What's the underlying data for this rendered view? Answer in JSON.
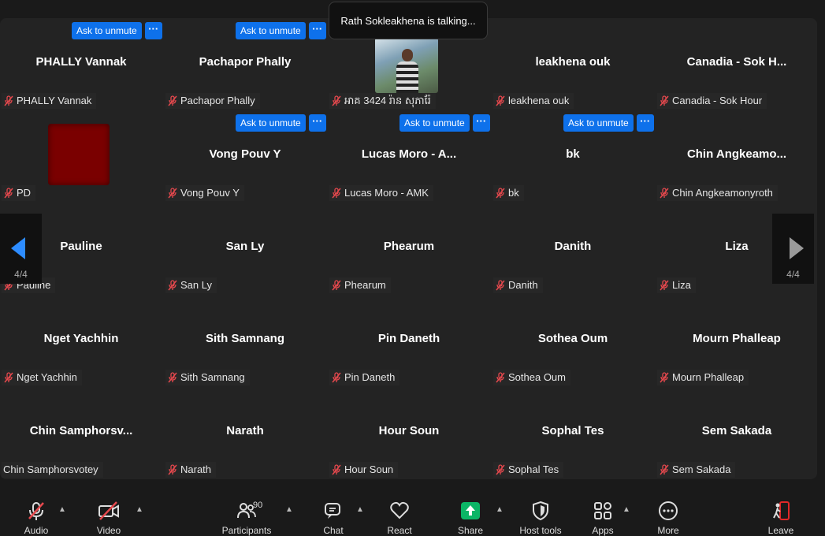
{
  "talking_indicator": "Rath Sokleakhena is talking...",
  "unmute_label": "Ask to unmute",
  "more_dots": "···",
  "pagination": {
    "current": "4/4"
  },
  "participants": [
    {
      "display": "PHALLY Vannak",
      "tag": "PHALLY Vannak",
      "unmute": true
    },
    {
      "display": "Pachapor Phally",
      "tag": "Pachapor Phally",
      "unmute": true
    },
    {
      "display": "",
      "tag": "អាគ 3424 រ៉ាន សុភារ៉ែ",
      "unmute": false,
      "photo": true
    },
    {
      "display": "leakhena ouk",
      "tag": "leakhena ouk",
      "unmute": false
    },
    {
      "display": "Canadia - Sok H...",
      "tag": "Canadia - Sok Hour",
      "unmute": false
    },
    {
      "display": "",
      "tag": "PD",
      "unmute": false,
      "red_avatar": true
    },
    {
      "display": "Vong Pouv Y",
      "tag": "Vong Pouv Y",
      "unmute": true
    },
    {
      "display": "Lucas Moro - A...",
      "tag": "Lucas Moro - AMK",
      "unmute": true
    },
    {
      "display": "bk",
      "tag": "bk",
      "unmute": true
    },
    {
      "display": "Chin  Angkeamo...",
      "tag": "Chin Angkeamonyroth",
      "unmute": false
    },
    {
      "display": "Pauline",
      "tag": "Pauline",
      "unmute": false
    },
    {
      "display": "San Ly",
      "tag": "San Ly",
      "unmute": false
    },
    {
      "display": "Phearum",
      "tag": "Phearum",
      "unmute": false
    },
    {
      "display": "Danith",
      "tag": "Danith",
      "unmute": false
    },
    {
      "display": "Liza",
      "tag": "Liza",
      "unmute": false
    },
    {
      "display": "Nget Yachhin",
      "tag": "Nget Yachhin",
      "unmute": false
    },
    {
      "display": "Sith Samnang",
      "tag": "Sith Samnang",
      "unmute": false
    },
    {
      "display": "Pin Daneth",
      "tag": "Pin Daneth",
      "unmute": false
    },
    {
      "display": "Sothea Oum",
      "tag": "Sothea Oum",
      "unmute": false
    },
    {
      "display": "Mourn Phalleap",
      "tag": "Mourn Phalleap",
      "unmute": false
    },
    {
      "display": "Chin  Samphorsv...",
      "tag": "Chin Samphorsvotey",
      "unmute": false,
      "no_mic": true
    },
    {
      "display": "Narath",
      "tag": "Narath",
      "unmute": false
    },
    {
      "display": "Hour Soun",
      "tag": "Hour Soun",
      "unmute": false
    },
    {
      "display": "Sophal Tes",
      "tag": "Sophal Tes",
      "unmute": false
    },
    {
      "display": "Sem Sakada",
      "tag": "Sem Sakada",
      "unmute": false
    }
  ],
  "toolbar": {
    "audio": "Audio",
    "video": "Video",
    "participants": "Participants",
    "participants_count": "90",
    "chat": "Chat",
    "react": "React",
    "share": "Share",
    "host_tools": "Host tools",
    "apps": "Apps",
    "more": "More",
    "leave": "Leave"
  },
  "colors": {
    "accent": "#0e71eb",
    "share_green": "#0bb566",
    "leave_red": "#e02828",
    "muted_red": "#e5484d"
  }
}
